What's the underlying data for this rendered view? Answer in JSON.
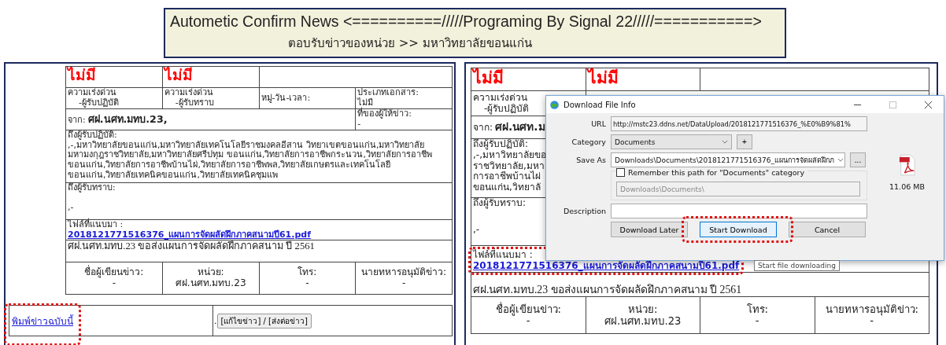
{
  "banner": {
    "title": "Autometic Confirm News <==========/////Programing By Signal 22/////===========>",
    "subtitle": "ตอบรับข่าวของหน่วย >> มหาวิทยาลัยขอนแก่น"
  },
  "panels": [
    {
      "priority": [
        "ไม่มี",
        "ไม่มี"
      ],
      "info_cells": [
        {
          "label": "ความเร่งด่วน",
          "value": "-ผู้รับปฏิบัติ"
        },
        {
          "label": "ความเร่งด่วน",
          "value": "-ผู้รับทราบ"
        },
        {
          "label": "หมู่-วัน-เวลา:"
        },
        {
          "label": "ประเภทเอกสาร:",
          "value": "ไม่มี"
        }
      ],
      "from": {
        "label": "จาก:",
        "value": "ศฝ.นศท.มทบ.23,"
      },
      "reference": {
        "label": "ที่ของผู้ให้ข่าว:",
        "value": "-"
      },
      "action_to": {
        "label": "ถึงผู้รับปฏิบัติ:",
        "text": ",-,มหาวิทยาลัยขอนแก่น,มหาวิทยาลัยเทคโนโลยีราชมงคลอีสาน วิทยาเขตขอนแก่น,มหาวิทยาลัยมหามงกุฎราชวิทยาลัย,มหาวิทยาลัยศรีปทุม ขอนแก่น,วิทยาลัยการอาชีพกระนวน,วิทยาลัยการอาชีพขอนแก่น,วิทยาลัยการอาชีพบ้านไผ่,วิทยาลัยการอาชีพพล,วิทยาลัยเกษตรและเทคโนโลยีขอนแก่น,วิทยาลัยเทคนิคขอนแก่น,วิทยาลัยเทคนิคชุมแพ"
      },
      "info_to": {
        "label": "ถึงผู้รับทราบ:",
        "value": ",-"
      },
      "attachment": {
        "label": "ไฟล์ที่แนบมา :",
        "link": "2018121771516376_แผนการจัดผลัดฝึกภาคสนามปี61.pdf"
      },
      "subject": "ศฝ.นศท.มทบ.23 ขอส่งแผนการจัดผลัดฝึกภาคสนาม ปี 2561",
      "footer": [
        {
          "label": "ชื่อผู้เขียนข่าว:",
          "value": "-"
        },
        {
          "label": "หน่วย:",
          "value": "ศฝ.นศท.มทบ.23"
        },
        {
          "label": "โทร:",
          "value": "-"
        },
        {
          "label": "นายทหารอนุมัติข่าว:",
          "value": "-"
        }
      ],
      "actions": {
        "print_link": "พิมพ์ข่าวฉบับนี้",
        "separator": ".",
        "edit_button": "[แก้ไขข่าว] / [ส่งต่อข่าว]"
      }
    },
    {
      "priority": [
        "ไม่มี",
        "ไม่มี"
      ],
      "info_cells": [
        {
          "label": "ความเร่งด่วน",
          "value": "-ผู้รับปฏิบัติ"
        }
      ],
      "from": {
        "label": "จาก:",
        "value": "ศฝ.นศท.ม"
      },
      "action_to": {
        "label": "ถึงผู้รับปฏิบัติ:",
        "lines": [
          ",-,มหาวิทยาลัยขอ",
          "ราชวิทยาลัย,มหา",
          "การอาชีพบ้านไผ่",
          "ขอนแก่น,วิทยาลั"
        ]
      },
      "info_to": {
        "label": "ถึงผู้รับทราบ:",
        "value": ",-"
      },
      "attachment": {
        "label": "ไฟล์ที่แนบมา :",
        "link": "2018121771516376_แผนการจัดผลัดฝึกภาคสนามปี61.pdf"
      },
      "subject": "ศฝ.นศท.มทบ.23 ขอส่งแผนการจัดผลัดฝึกภาคสนาม ปี 2561",
      "footer": [
        {
          "label": "ชื่อผู้เขียนข่าว:",
          "value": "-"
        },
        {
          "label": "หน่วย:",
          "value": "ศฝ.นศท.มทบ.23"
        },
        {
          "label": "โทร:",
          "value": "-"
        },
        {
          "label": "นายทหารอนุมัติข่าว:",
          "value": "-"
        }
      ]
    }
  ],
  "dialog": {
    "title": "Download File Info",
    "url": {
      "label": "URL",
      "value": "http://mstc23.ddns.net/DataUpload/2018121771516376_%E0%B9%81%"
    },
    "category": {
      "label": "Category",
      "value": "Documents",
      "add": "+"
    },
    "save_as": {
      "label": "Save As",
      "value": "Downloads\\Documents\\2018121771516376_แผนการจัดผลัดฝึกภ",
      "browse": "..."
    },
    "remember": {
      "label": "Remember this path for \"Documents\" category",
      "checked": false,
      "path": "Downloads\\Documents\\"
    },
    "description": {
      "label": "Description"
    },
    "file_size": "11.06  MB",
    "buttons": [
      {
        "label": "Download Later",
        "default": false
      },
      {
        "label": "Start Download",
        "default": true
      },
      {
        "label": "Cancel",
        "default": false
      }
    ],
    "tooltip": "Start file downloading"
  }
}
